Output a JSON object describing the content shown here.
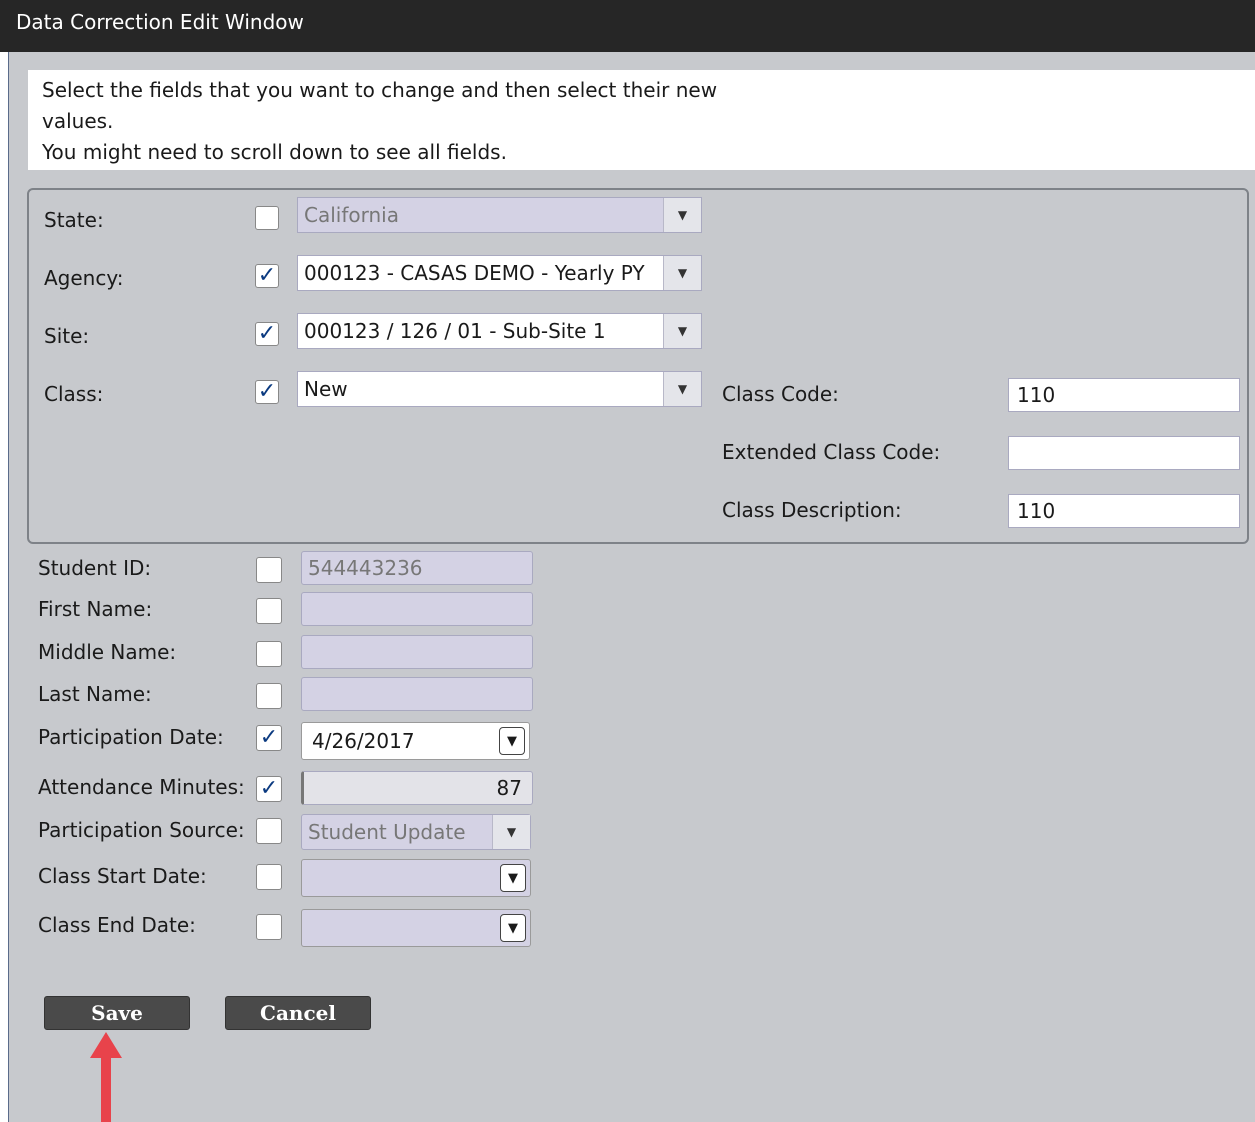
{
  "window": {
    "title": "Data Correction Edit Window"
  },
  "instructions": {
    "line1": "Select the fields that you want to change and then select their new",
    "line2": "values.",
    "line3": "You might need to scroll down to see all fields."
  },
  "group": {
    "state": {
      "label": "State:",
      "checked": false,
      "value": "California"
    },
    "agency": {
      "label": "Agency:",
      "checked": true,
      "value": "000123 - CASAS DEMO - Yearly PY"
    },
    "site": {
      "label": "Site:",
      "checked": true,
      "value": "000123 / 126 / 01 - Sub-Site 1"
    },
    "class": {
      "label": "Class:",
      "checked": true,
      "value": "New"
    },
    "class_code": {
      "label": "Class Code:",
      "value": "110"
    },
    "extended_class_code": {
      "label": "Extended Class Code:",
      "value": ""
    },
    "class_description": {
      "label": "Class Description:",
      "value": "110"
    }
  },
  "fields": {
    "student_id": {
      "label": "Student ID:",
      "checked": false,
      "value": "544443236"
    },
    "first_name": {
      "label": "First Name:",
      "checked": false,
      "value": ""
    },
    "middle_name": {
      "label": "Middle Name:",
      "checked": false,
      "value": ""
    },
    "last_name": {
      "label": "Last Name:",
      "checked": false,
      "value": ""
    },
    "participation_date": {
      "label": "Participation Date:",
      "checked": true,
      "value": "4/26/2017"
    },
    "attendance_minutes": {
      "label": "Attendance Minutes:",
      "checked": true,
      "value": "87"
    },
    "participation_source": {
      "label": "Participation Source:",
      "checked": false,
      "value": "Student Update"
    },
    "class_start_date": {
      "label": "Class Start Date:",
      "checked": false,
      "value": ""
    },
    "class_end_date": {
      "label": "Class End Date:",
      "checked": false,
      "value": ""
    }
  },
  "buttons": {
    "save": "Save",
    "cancel": "Cancel"
  },
  "colors": {
    "titlebar": "#262626",
    "panel": "#c7c9cd",
    "disabled_field": "#d4d2e4",
    "check": "#0b3a80",
    "button": "#4a4a4a",
    "arrow": "#e8434b"
  },
  "icons": {
    "check": "✓",
    "dropdown": "▼",
    "annotation": "red-up-arrow"
  }
}
